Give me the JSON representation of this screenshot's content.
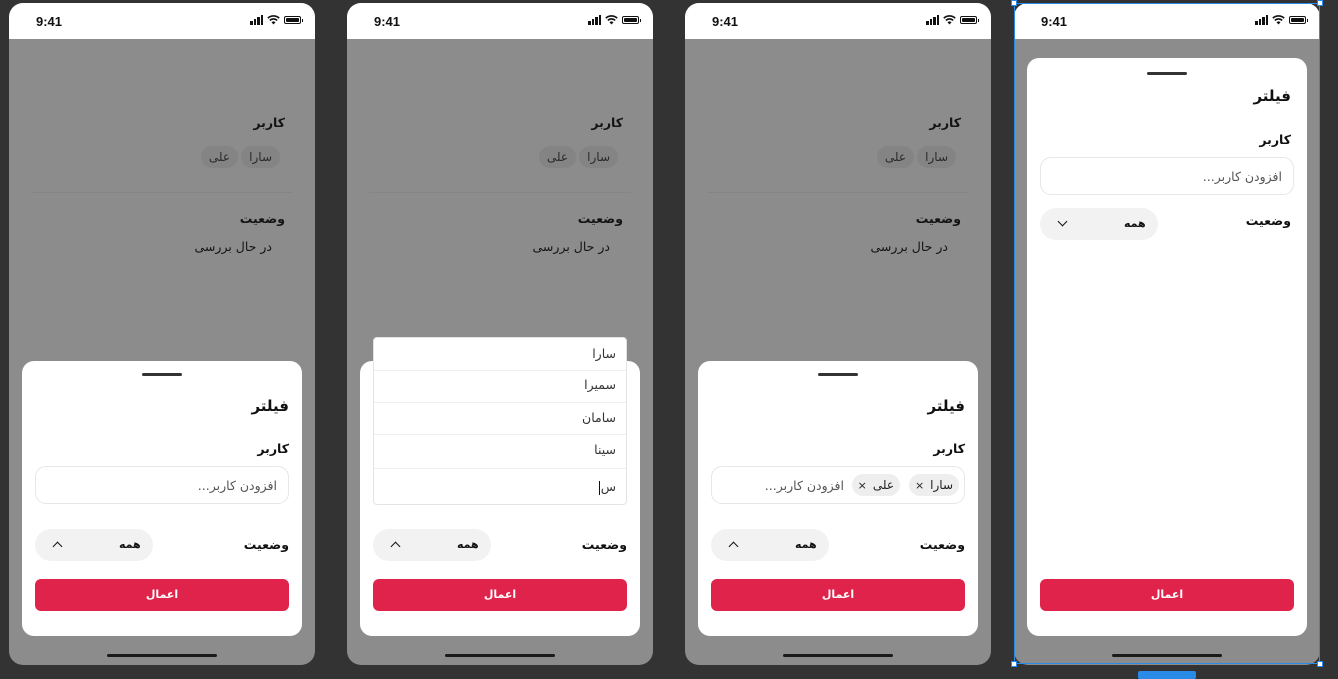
{
  "status_time": "9:41",
  "frames": [
    {
      "background": {
        "user_label": "کاربر",
        "chips": [
          "سارا",
          "علی"
        ],
        "status_label": "وضعیت",
        "status_value": "در حال بررسی"
      },
      "sheet": {
        "title": "فیلتر",
        "user_label": "کاربر",
        "placeholder": "افزودن کاربر...",
        "status_label": "وضعیت",
        "status_value": "همه",
        "apply": "اعمال"
      }
    },
    {
      "background": {
        "user_label": "کاربر",
        "chips": [
          "سارا",
          "علی"
        ],
        "status_label": "وضعیت",
        "status_value": "در حال بررسی"
      },
      "dropdown": {
        "options": [
          "سارا",
          "سمیرا",
          "سامان",
          "سینا"
        ],
        "input_value": "س"
      },
      "sheet": {
        "status_label": "وضعیت",
        "status_value": "همه",
        "apply": "اعمال"
      }
    },
    {
      "background": {
        "user_label": "کاربر",
        "chips": [
          "سارا",
          "علی"
        ],
        "status_label": "وضعیت",
        "status_value": "در حال بررسی"
      },
      "sheet": {
        "title": "فیلتر",
        "user_label": "کاربر",
        "tags": [
          "سارا",
          "علی"
        ],
        "tag_remove": "×",
        "placeholder": "افزودن کاربر...",
        "status_label": "وضعیت",
        "status_value": "همه",
        "apply": "اعمال"
      }
    },
    {
      "sheet": {
        "title": "فیلتر",
        "user_label": "کاربر",
        "placeholder": "افزودن کاربر...",
        "status_label": "وضعیت",
        "status_value": "همه",
        "apply": "اعمال"
      }
    }
  ],
  "colors": {
    "canvas": "#333333",
    "scrim": "#8c8c8c",
    "accent": "#e0234a",
    "selection": "#2a8ae8"
  }
}
